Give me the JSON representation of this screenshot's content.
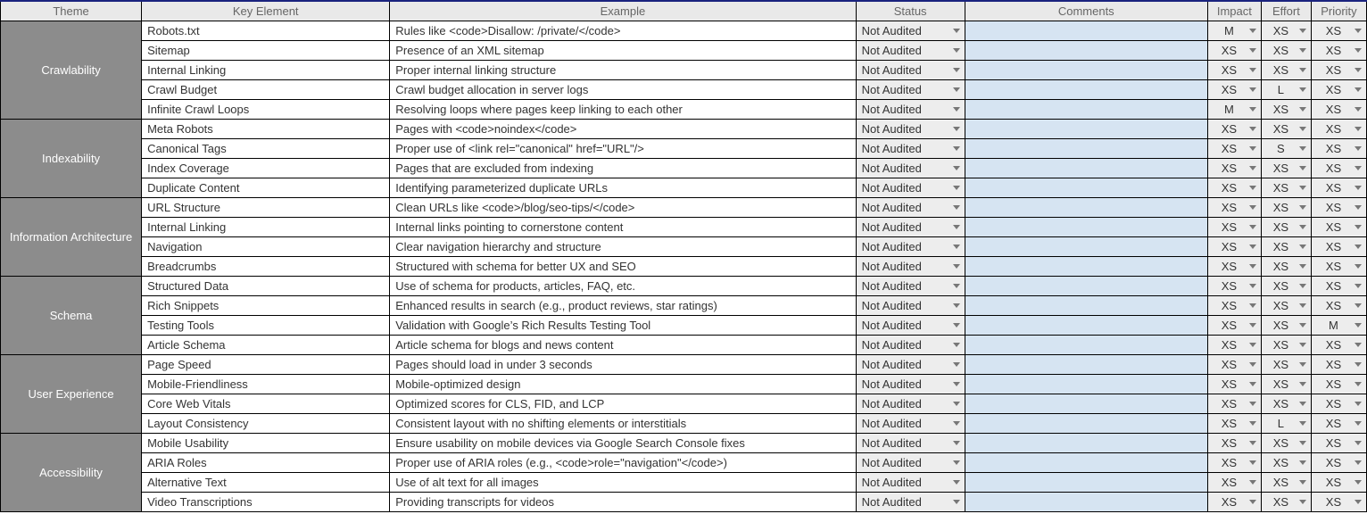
{
  "columns": {
    "theme": "Theme",
    "key": "Key Element",
    "example": "Example",
    "status": "Status",
    "comments": "Comments",
    "impact": "Impact",
    "effort": "Effort",
    "priority": "Priority"
  },
  "groups": [
    {
      "theme": "Crawlability",
      "rows": [
        {
          "key": "Robots.txt",
          "example": "Rules like <code>Disallow: /private/</code>",
          "status": "Not Audited",
          "comments": "",
          "impact": "M",
          "effort": "XS",
          "priority": "XS"
        },
        {
          "key": "Sitemap",
          "example": "Presence of an XML sitemap",
          "status": "Not Audited",
          "comments": "",
          "impact": "XS",
          "effort": "XS",
          "priority": "XS"
        },
        {
          "key": "Internal Linking",
          "example": "Proper internal linking structure",
          "status": "Not Audited",
          "comments": "",
          "impact": "XS",
          "effort": "XS",
          "priority": "XS"
        },
        {
          "key": "Crawl Budget",
          "example": "Crawl budget allocation in server logs",
          "status": "Not Audited",
          "comments": "",
          "impact": "XS",
          "effort": "L",
          "priority": "XS"
        },
        {
          "key": "Infinite Crawl Loops",
          "example": "Resolving loops where pages keep linking to each other",
          "status": "Not Audited",
          "comments": "",
          "impact": "M",
          "effort": "XS",
          "priority": "XS"
        }
      ]
    },
    {
      "theme": "Indexability",
      "rows": [
        {
          "key": "Meta Robots",
          "example": "Pages with <code>noindex</code>",
          "status": "Not Audited",
          "comments": "",
          "impact": "XS",
          "effort": "XS",
          "priority": "XS"
        },
        {
          "key": "Canonical Tags",
          "example": "Proper use of <link rel=\"canonical\" href=\"URL\"/>",
          "status": "Not Audited",
          "comments": "",
          "impact": "XS",
          "effort": "S",
          "priority": "XS"
        },
        {
          "key": "Index Coverage",
          "example": "Pages that are excluded from indexing",
          "status": "Not Audited",
          "comments": "",
          "impact": "XS",
          "effort": "XS",
          "priority": "XS"
        },
        {
          "key": "Duplicate Content",
          "example": "Identifying parameterized duplicate URLs",
          "status": "Not Audited",
          "comments": "",
          "impact": "XS",
          "effort": "XS",
          "priority": "XS"
        }
      ]
    },
    {
      "theme": "Information Architecture",
      "rows": [
        {
          "key": "URL Structure",
          "example": "Clean URLs like <code>/blog/seo-tips/</code>",
          "status": "Not Audited",
          "comments": "",
          "impact": "XS",
          "effort": "XS",
          "priority": "XS"
        },
        {
          "key": "Internal Linking",
          "example": "Internal links pointing to cornerstone content",
          "status": "Not Audited",
          "comments": "",
          "impact": "XS",
          "effort": "XS",
          "priority": "XS"
        },
        {
          "key": "Navigation",
          "example": "Clear navigation hierarchy and structure",
          "status": "Not Audited",
          "comments": "",
          "impact": "XS",
          "effort": "XS",
          "priority": "XS"
        },
        {
          "key": "Breadcrumbs",
          "example": "Structured with schema for better UX and SEO",
          "status": "Not Audited",
          "comments": "",
          "impact": "XS",
          "effort": "XS",
          "priority": "XS"
        }
      ]
    },
    {
      "theme": "Schema",
      "rows": [
        {
          "key": "Structured Data",
          "example": "Use of schema for products, articles, FAQ, etc.",
          "status": "Not Audited",
          "comments": "",
          "impact": "XS",
          "effort": "XS",
          "priority": "XS"
        },
        {
          "key": "Rich Snippets",
          "example": "Enhanced results in search (e.g., product reviews, star ratings)",
          "status": "Not Audited",
          "comments": "",
          "impact": "XS",
          "effort": "XS",
          "priority": "XS"
        },
        {
          "key": "Testing Tools",
          "example": "Validation with Google’s Rich Results Testing Tool",
          "status": "Not Audited",
          "comments": "",
          "impact": "XS",
          "effort": "XS",
          "priority": "M"
        },
        {
          "key": "Article Schema",
          "example": "Article schema for blogs and news content",
          "status": "Not Audited",
          "comments": "",
          "impact": "XS",
          "effort": "XS",
          "priority": "XS"
        }
      ]
    },
    {
      "theme": "User Experience",
      "rows": [
        {
          "key": "Page Speed",
          "example": "Pages should load in under 3 seconds",
          "status": "Not Audited",
          "comments": "",
          "impact": "XS",
          "effort": "XS",
          "priority": "XS"
        },
        {
          "key": "Mobile-Friendliness",
          "example": "Mobile-optimized design",
          "status": "Not Audited",
          "comments": "",
          "impact": "XS",
          "effort": "XS",
          "priority": "XS"
        },
        {
          "key": "Core Web Vitals",
          "example": "Optimized scores for CLS, FID, and LCP",
          "status": "Not Audited",
          "comments": "",
          "impact": "XS",
          "effort": "XS",
          "priority": "XS"
        },
        {
          "key": "Layout Consistency",
          "example": "Consistent layout with no shifting elements or interstitials",
          "status": "Not Audited",
          "comments": "",
          "impact": "XS",
          "effort": "L",
          "priority": "XS"
        }
      ]
    },
    {
      "theme": "Accessibility",
      "rows": [
        {
          "key": "Mobile Usability",
          "example": "Ensure usability on mobile devices via Google Search Console fixes",
          "status": "Not Audited",
          "comments": "",
          "impact": "XS",
          "effort": "XS",
          "priority": "XS"
        },
        {
          "key": "ARIA Roles",
          "example": "Proper use of ARIA roles (e.g., <code>role=\"navigation\"</code>)",
          "status": "Not Audited",
          "comments": "",
          "impact": "XS",
          "effort": "XS",
          "priority": "XS"
        },
        {
          "key": "Alternative Text",
          "example": "Use of alt text for all images",
          "status": "Not Audited",
          "comments": "",
          "impact": "XS",
          "effort": "XS",
          "priority": "XS"
        },
        {
          "key": "Video Transcriptions",
          "example": "Providing transcripts for videos",
          "status": "Not Audited",
          "comments": "",
          "impact": "XS",
          "effort": "XS",
          "priority": "XS"
        }
      ]
    }
  ]
}
